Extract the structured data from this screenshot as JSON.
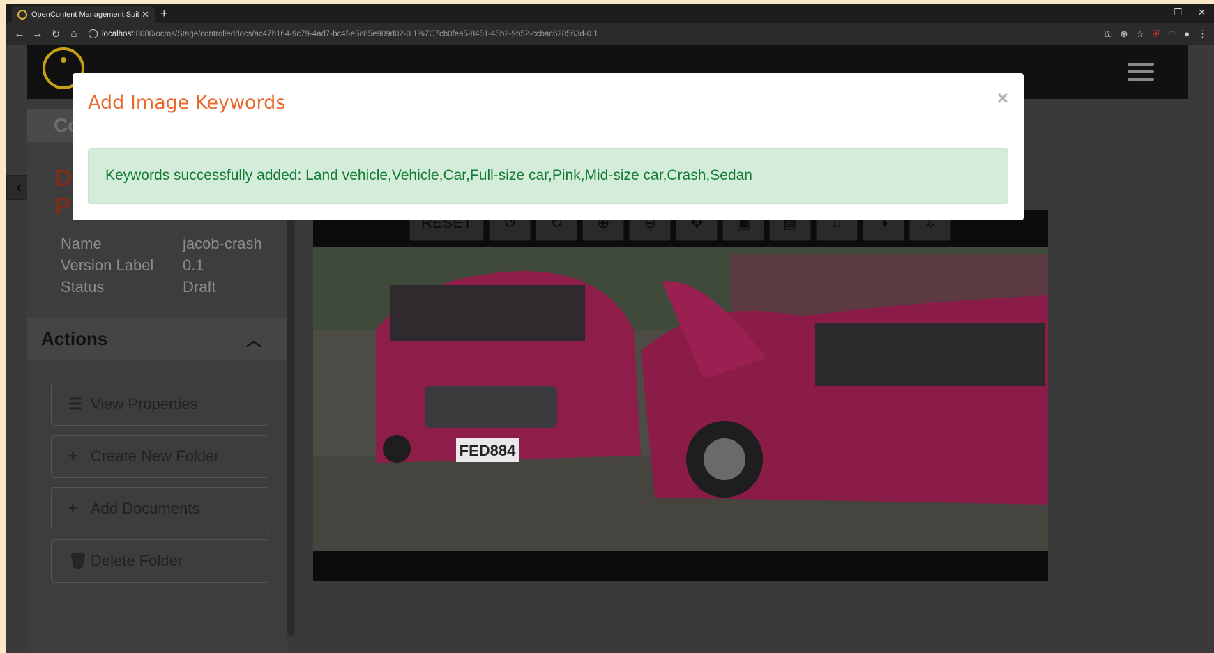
{
  "browser": {
    "tab_title": "OpenContent Management Suite",
    "url_host": "localhost",
    "url_path": ":8080/ocms/Stage/controlleddocs/ac47b164-9c79-4ad7-bc4f-e5c85e909d02-0.1%7C7cb0fea5-8451-45b2-9b52-ccbac628563d-0.1"
  },
  "sidebar": {
    "collapsed_title": "Co",
    "doc_title_line1": "D",
    "doc_title_line2": "Pr",
    "props": [
      {
        "label": "Name",
        "value": "jacob-crash"
      },
      {
        "label": "Version Label",
        "value": "0.1"
      },
      {
        "label": "Status",
        "value": "Draft"
      }
    ],
    "actions_title": "Actions",
    "actions": [
      {
        "label": "View Properties",
        "icon": "list-icon"
      },
      {
        "label": "Create New Folder",
        "icon": "plus-icon"
      },
      {
        "label": "Add Documents",
        "icon": "plus-icon"
      },
      {
        "label": "Delete Folder",
        "icon": "trash-icon"
      }
    ]
  },
  "viewer": {
    "reset_label": "RESET",
    "plate": "FED884"
  },
  "modal": {
    "title": "Add Image Keywords",
    "close": "×",
    "message": "Keywords successfully added: Land vehicle,Vehicle,Car,Full-size car,Pink,Mid-size car,Crash,Sedan"
  },
  "colors": {
    "modal_title": "#e8692a",
    "alert_bg": "#d4edda",
    "alert_text": "#157a33",
    "logo": "#c8a016"
  }
}
